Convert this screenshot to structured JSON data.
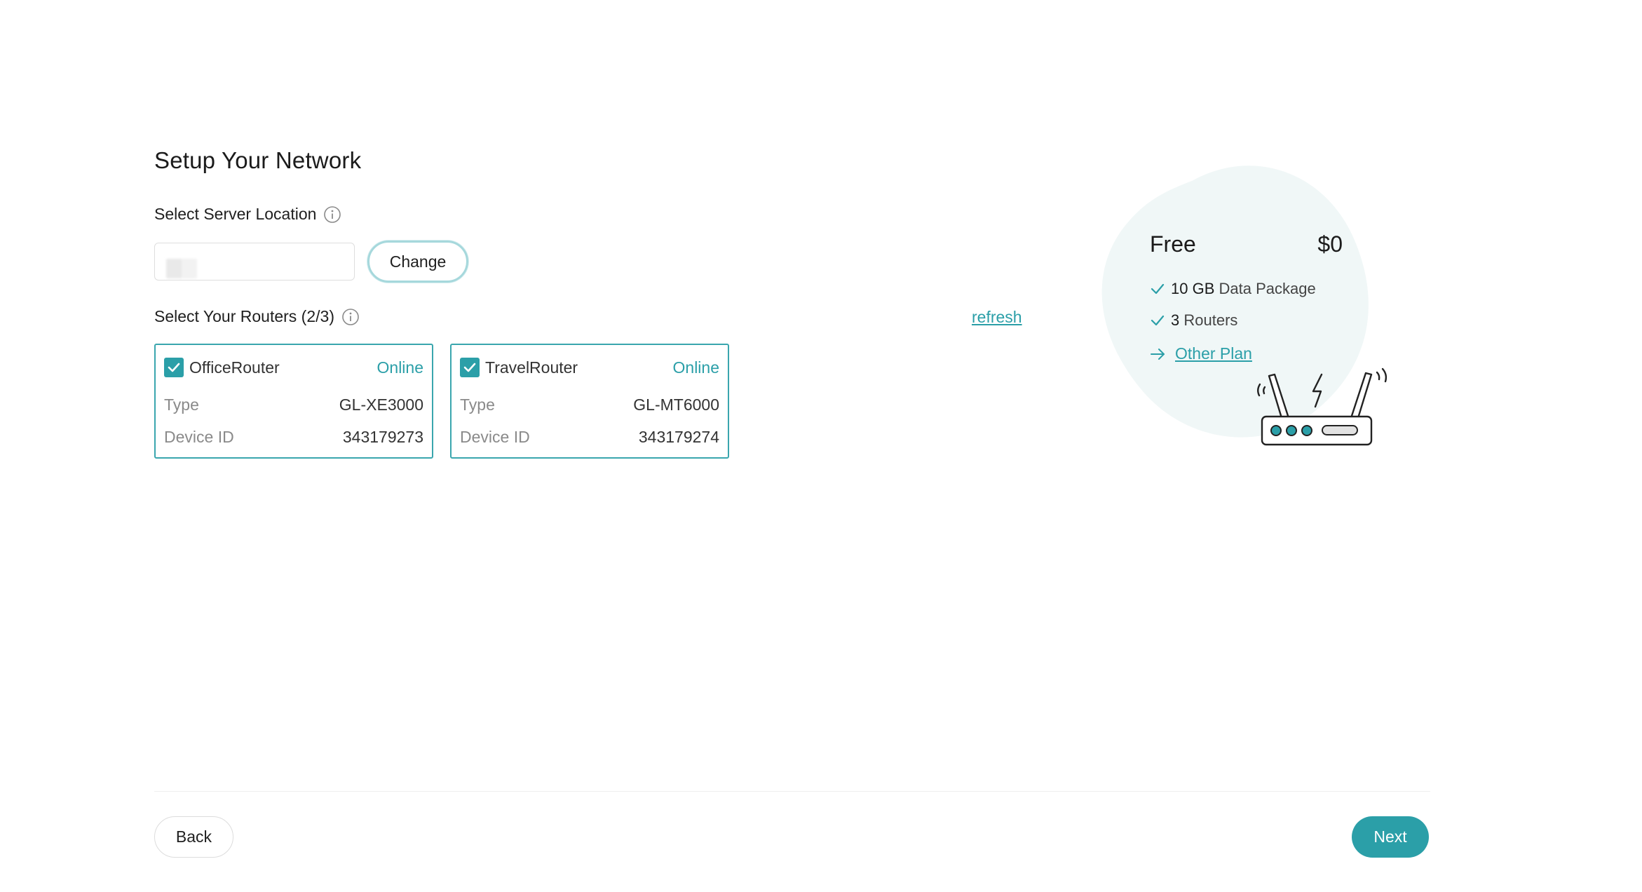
{
  "page": {
    "title": "Setup Your Network"
  },
  "server_location": {
    "label": "Select Server Location",
    "value": "",
    "change_label": "Change"
  },
  "routers": {
    "label": "Select Your Routers (2/3)",
    "refresh_label": "refresh",
    "type_label": "Type",
    "device_id_label": "Device ID",
    "items": [
      {
        "name": "OfficeRouter",
        "status": "Online",
        "type": "GL-XE3000",
        "device_id": "343179273",
        "checked": true
      },
      {
        "name": "TravelRouter",
        "status": "Online",
        "type": "GL-MT6000",
        "device_id": "343179274",
        "checked": true
      }
    ]
  },
  "plan": {
    "name": "Free",
    "price": "$0",
    "features": [
      {
        "value": "10 GB",
        "text": "Data Package"
      },
      {
        "value": "3",
        "text": "Routers"
      }
    ],
    "other_plan_label": "Other Plan"
  },
  "footer": {
    "back_label": "Back",
    "next_label": "Next"
  },
  "colors": {
    "accent": "#2b9fa8",
    "blob": "#f0f7f7"
  },
  "icons": {
    "info": "info-icon",
    "check": "check-icon",
    "arrow": "arrow-right-icon",
    "router": "router-illustration"
  }
}
